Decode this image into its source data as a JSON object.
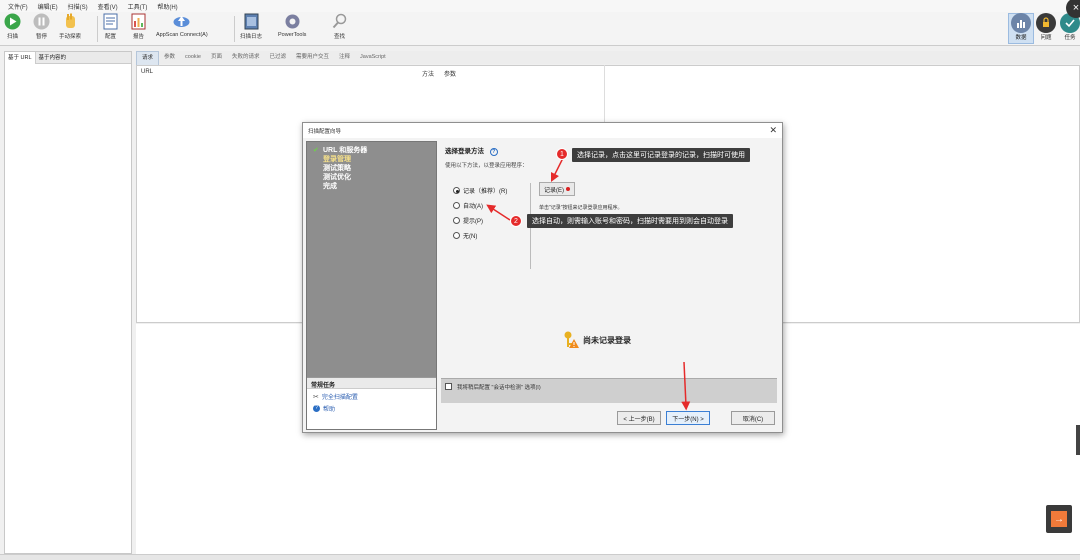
{
  "menu": [
    "文件(F)",
    "编辑(E)",
    "扫描(S)",
    "查看(V)",
    "工具(T)",
    "帮助(H)"
  ],
  "toolbar": {
    "scan": "扫描",
    "pause": "暂停",
    "manual_explore": "手动探索",
    "config": "配置",
    "report": "报告",
    "appscan_connect": "AppScan Connect(A)",
    "scan_log": "扫描日志",
    "powertools": "PowerTools",
    "find": "查找"
  },
  "toolbar_right": {
    "data": "数据",
    "issues": "问题",
    "tasks": "任务"
  },
  "left_tabs": [
    "基于 URL",
    "基于内容的"
  ],
  "detail_tabs": [
    "请求",
    "参数",
    "cookie",
    "页面",
    "失败的请求",
    "已过滤",
    "需要用户交互",
    "注释",
    "JavaScript"
  ],
  "list_headers": {
    "url": "URL",
    "method": "方法",
    "params": "参数"
  },
  "dialog": {
    "title": "扫描配置向导",
    "steps": [
      "URL 和服务器",
      "登录管理",
      "测试策略",
      "测试优化",
      "完成"
    ],
    "tasks_header": "常规任务",
    "tasks": [
      "完全扫描配置",
      "帮助"
    ],
    "section_title": "选择登录方法",
    "section_desc": "使用以下方法，以登录应用程序：",
    "options": [
      "记录（推荐）(R)",
      "自动(A)",
      "提示(P)",
      "无(N)"
    ],
    "selected_option": "记录（推荐）(R)",
    "record_button": "记录(E)",
    "record_hint": "单击\"记录\"按钮来记录登录应用程序。",
    "not_recorded": "尚未记录登录",
    "checkbox_label": "我将稍后配置 \"会话中检测\" 选项(I)",
    "buttons": {
      "prev": "< 上一步(B)",
      "next": "下一步(N) >",
      "cancel": "取消(C)"
    }
  },
  "callouts": [
    {
      "badge": "1",
      "text": "选择记录，点击这里可记录登录的记录，扫描时可使用"
    },
    {
      "badge": "2",
      "text": "选择自动，则需输入账号和密码，扫描时需要用到则会自动登录"
    }
  ],
  "colors": {
    "accent": "#3b7fd4",
    "callout_bg": "#3d3d3d",
    "badge": "#e52b2b",
    "arrow": "#e52b2b"
  }
}
